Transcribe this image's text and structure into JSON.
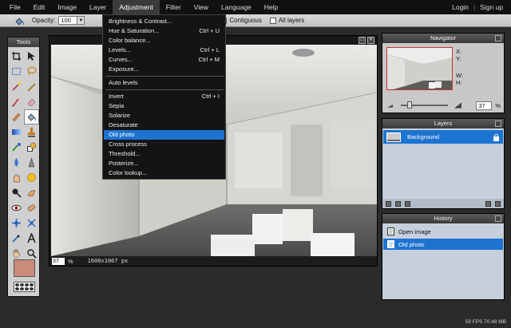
{
  "menubar": {
    "items": [
      "File",
      "Edit",
      "Image",
      "Layer",
      "Adjustment",
      "Filter",
      "View",
      "Language",
      "Help"
    ],
    "login": "Login",
    "separator": "|",
    "signup": "Sign up"
  },
  "options": {
    "opacity_label": "Opacity:",
    "opacity_value": "100",
    "contiguous_label": "Contiguous",
    "contiguous_mark": "✓",
    "all_layers_label": "All layers"
  },
  "tools": {
    "title": "Tools",
    "selected": "paint-bucket",
    "foreground_color": "#c98b7a"
  },
  "adjustment_menu": {
    "items": [
      {
        "label": "Brightness & Contrast...",
        "shortcut": ""
      },
      {
        "label": "Hue & Saturation...",
        "shortcut": "Ctrl + U"
      },
      {
        "label": "Color balance...",
        "shortcut": ""
      },
      {
        "label": "Levels...",
        "shortcut": "Ctrl + L"
      },
      {
        "label": "Curves...",
        "shortcut": "Ctrl + M"
      },
      {
        "label": "Exposure...",
        "shortcut": ""
      },
      {
        "label": "Auto levels",
        "shortcut": ""
      },
      {
        "label": "Invert",
        "shortcut": "Ctrl + I"
      },
      {
        "label": "Sepia",
        "shortcut": ""
      },
      {
        "label": "Solarize",
        "shortcut": ""
      },
      {
        "label": "Desaturate",
        "shortcut": ""
      },
      {
        "label": "Old photo",
        "shortcut": ""
      },
      {
        "label": "Cross process",
        "shortcut": ""
      },
      {
        "label": "Threshold...",
        "shortcut": ""
      },
      {
        "label": "Posterize...",
        "shortcut": ""
      },
      {
        "label": "Color lookup...",
        "shortcut": ""
      }
    ],
    "active": "Old photo"
  },
  "image_window": {
    "zoom": "37",
    "zoom_unit": "%",
    "dimensions": "1600x1067 px"
  },
  "navigator": {
    "title": "Navigator",
    "x_label": "X:",
    "y_label": "Y:",
    "w_label": "W:",
    "h_label": "H:",
    "zoom": "37",
    "zoom_unit": "%"
  },
  "layers": {
    "title": "Layers",
    "items": [
      "Background"
    ]
  },
  "history": {
    "title": "History",
    "items": [
      "Open image",
      "Old photo"
    ],
    "active": "Old photo"
  },
  "status": {
    "fps": "59 FPS 70,48 MB"
  },
  "colors": {
    "accent": "#1c73d0",
    "menubar": "#111111",
    "panel_bg": "#c6cfdb"
  }
}
